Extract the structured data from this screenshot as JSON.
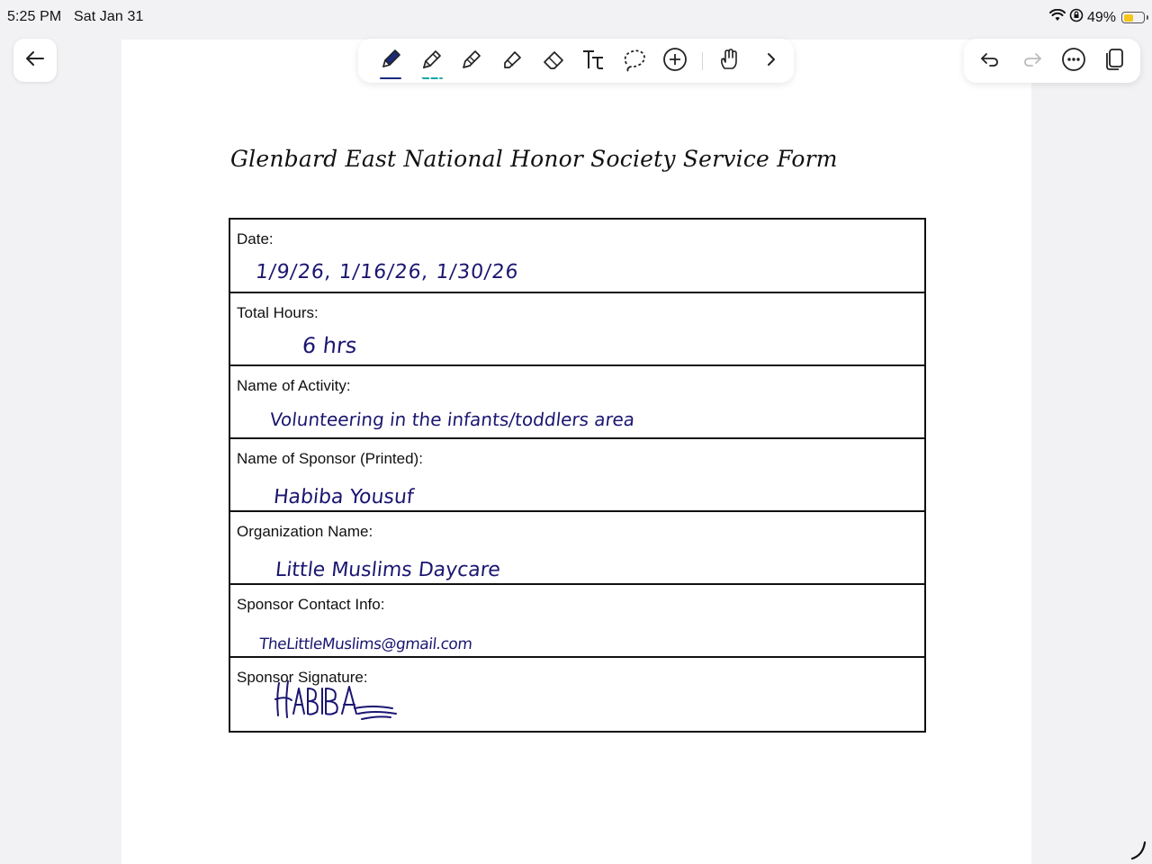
{
  "status_bar": {
    "time": "5:25 PM",
    "date": "Sat Jan 31",
    "battery": "49%",
    "battery_level": 0.49
  },
  "toolbar": {
    "tools": [
      {
        "name": "pen-tool",
        "icon": "pen-icon",
        "selected": true
      },
      {
        "name": "pencil-tool",
        "icon": "pencil-icon"
      },
      {
        "name": "fountain-pen-tool",
        "icon": "fountain-pen-icon"
      },
      {
        "name": "highlighter-tool",
        "icon": "highlighter-icon"
      },
      {
        "name": "eraser-tool",
        "icon": "eraser-icon"
      },
      {
        "name": "text-tool",
        "icon": "text-icon"
      },
      {
        "name": "lasso-tool",
        "icon": "lasso-icon"
      },
      {
        "name": "add-tool",
        "icon": "plus-circle-icon"
      },
      {
        "name": "touch-tool",
        "icon": "hand-icon"
      },
      {
        "name": "more-tools",
        "icon": "chevron-right-icon"
      }
    ],
    "accent": "#1a2a7a"
  },
  "document": {
    "title": "Glenbard East National Honor Society Service Form",
    "ink_color": "#1b1670",
    "rows": [
      {
        "label": "Date:",
        "value": "1/9/26, 1/16/26, 1/30/26"
      },
      {
        "label": "Total Hours:",
        "value": "6 hrs"
      },
      {
        "label": "Name of Activity:",
        "value": "Volunteering in the infants/toddlers area"
      },
      {
        "label": "Name of Sponsor (Printed):",
        "value": "Habiba Yousuf"
      },
      {
        "label": "Organization Name:",
        "value": "Little Muslims Daycare"
      },
      {
        "label": "Sponsor Contact Info:",
        "value": "TheLittleMuslims@gmail.com"
      },
      {
        "label": "Sponsor Signature:",
        "value": "HABIBA"
      }
    ]
  }
}
